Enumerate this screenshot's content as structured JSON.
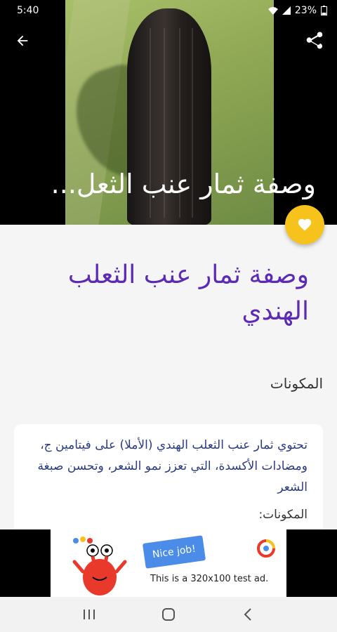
{
  "status_bar": {
    "time": "5:40",
    "battery": "23%"
  },
  "hero": {
    "title": "وصفة ثمار عنب الثعل..."
  },
  "article": {
    "title": "وصفة ثمار عنب الثعلب الهندي",
    "section_label": "المكونات",
    "body_text": "تحتوي ثمار عنب الثعلب الهندي (الأملا) على فيتامين ج، ومضادات الأكسدة، التي تعزز نمو الشعر، وتحسن صبغة الشعر",
    "ingredients_heading": "المكونات:"
  },
  "ad": {
    "bubble_text": "Nice job!",
    "caption": "This is a 320x100 test ad."
  },
  "colors": {
    "accent_title": "#5b2bb6",
    "fab": "#f6c21c",
    "body_text": "#2a3a86"
  },
  "icons": {
    "back": "arrow-left-icon",
    "share": "share-icon",
    "favorite": "heart-icon",
    "nav_recents": "recents-icon",
    "nav_home": "home-icon",
    "nav_back": "back-chevron-icon"
  }
}
